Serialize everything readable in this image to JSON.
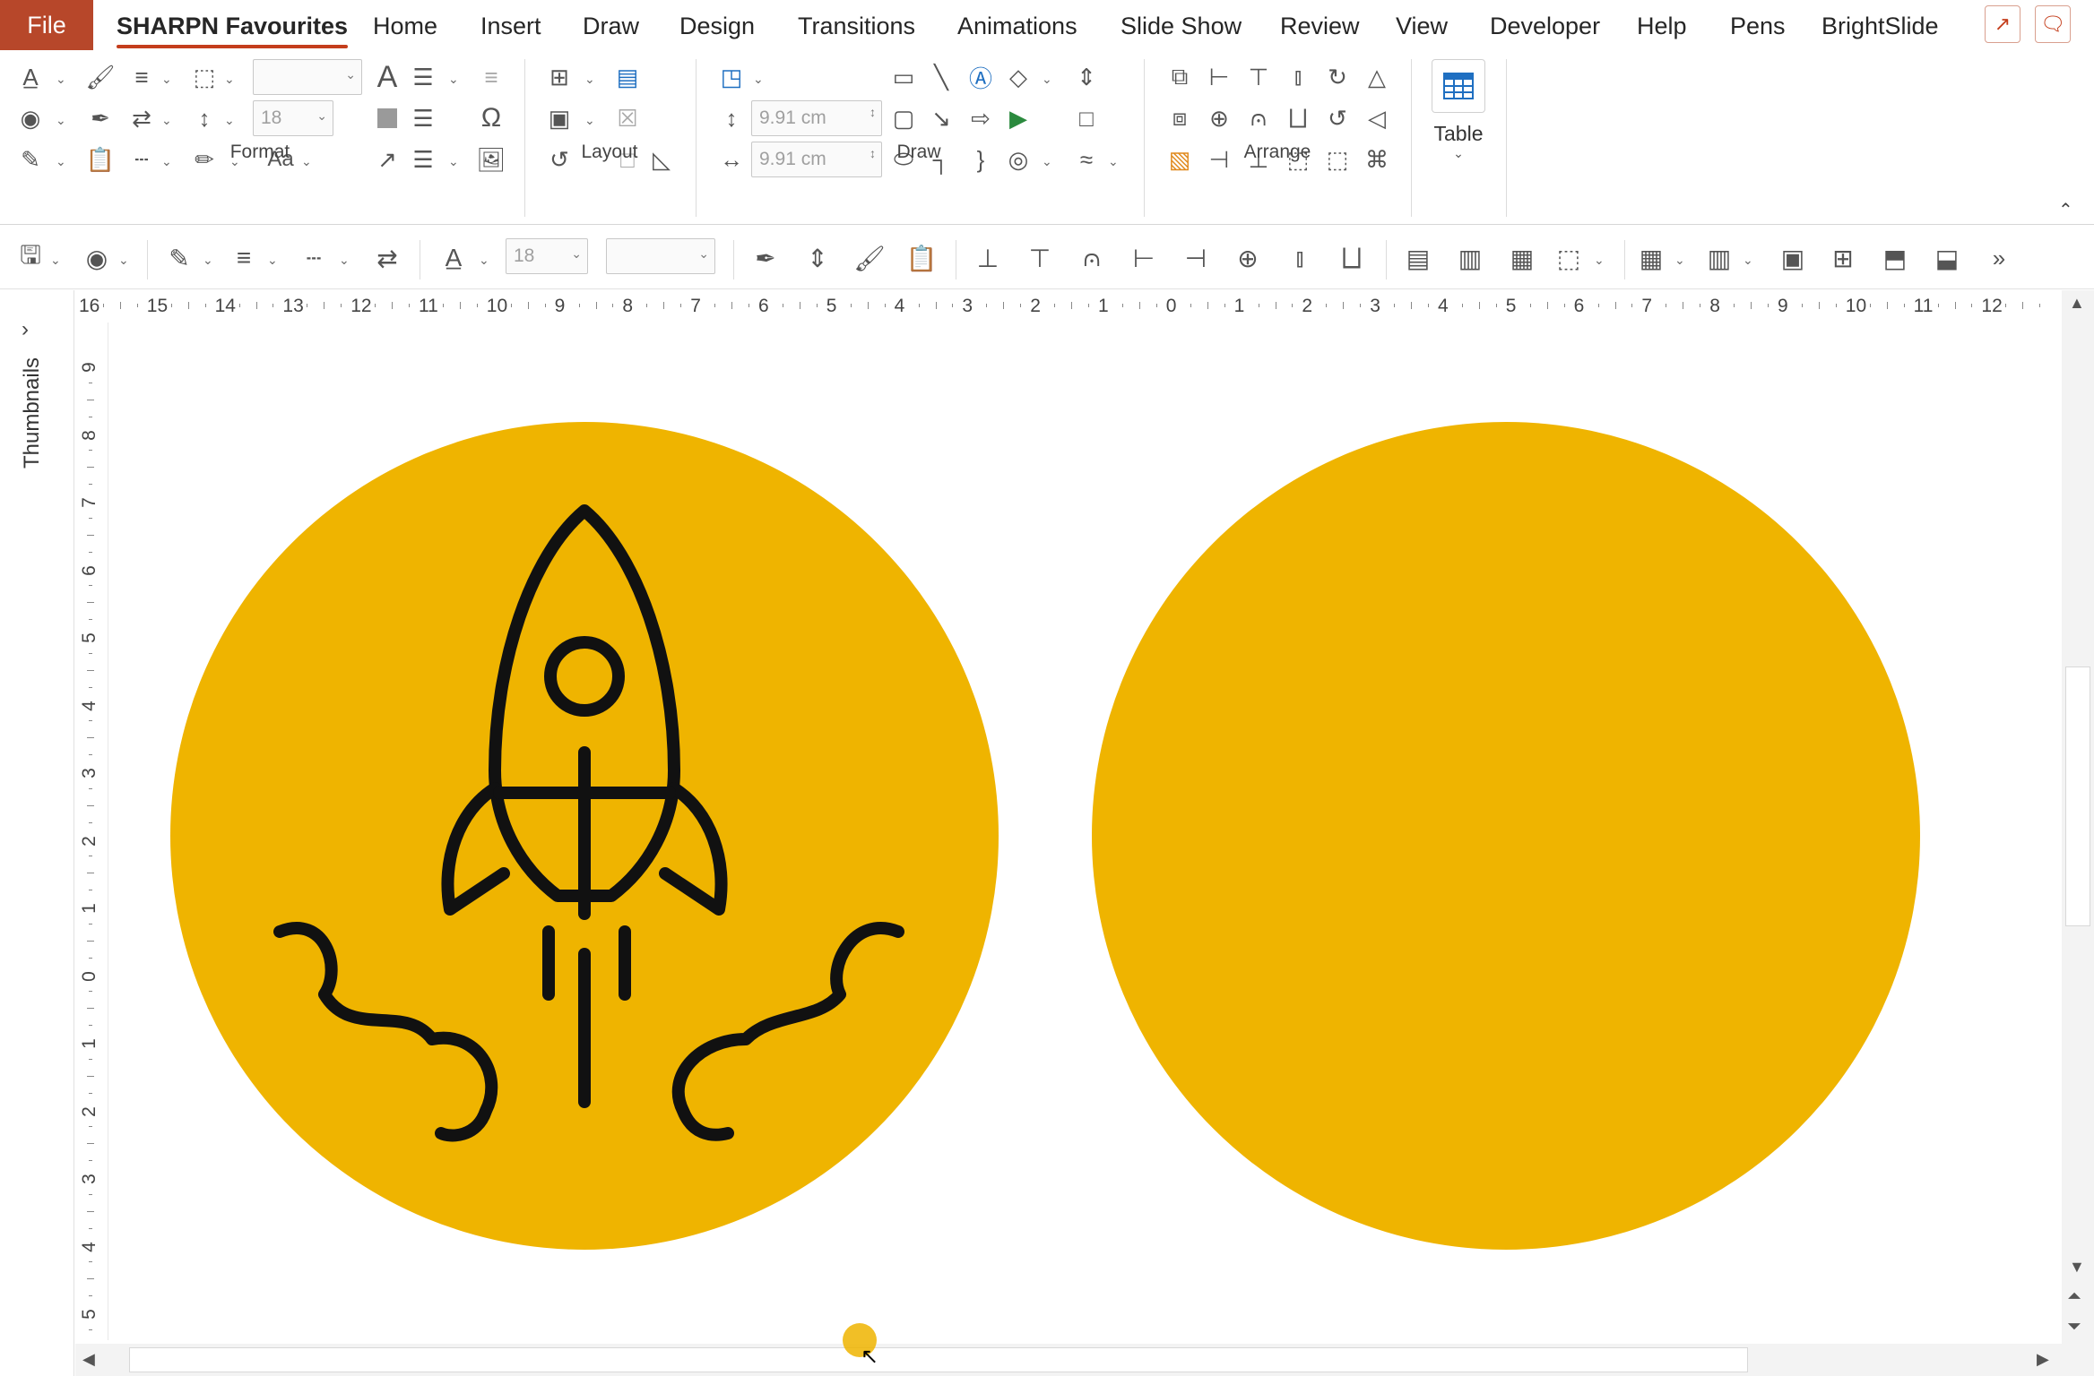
{
  "tabs": {
    "file": "File",
    "items": [
      "SHARPN Favourites",
      "Home",
      "Insert",
      "Draw",
      "Design",
      "Transitions",
      "Animations",
      "Slide Show",
      "Review",
      "View",
      "Developer",
      "Help",
      "Pens",
      "BrightSlide"
    ],
    "active": "SHARPN Favourites"
  },
  "ribbon": {
    "groups": {
      "format": "Format",
      "layout": "Layout",
      "draw": "Draw",
      "arrange": "Arrange"
    },
    "font_size_value": "18",
    "height_value": "9.91 cm",
    "width_value": "9.91 cm",
    "table_label": "Table",
    "text_case_label": "Aa"
  },
  "qat": {
    "font_size_value": "18",
    "more_label": "»"
  },
  "left_pane": {
    "label": "Thumbnails",
    "expand_icon": "chevron-right-icon"
  },
  "rulers": {
    "horizontal": [
      "16",
      "15",
      "14",
      "13",
      "12",
      "11",
      "10",
      "9",
      "8",
      "7",
      "6",
      "5",
      "4",
      "3",
      "2",
      "1",
      "0",
      "1",
      "2",
      "3",
      "4",
      "5",
      "6",
      "7",
      "8",
      "9",
      "10",
      "11",
      "12"
    ],
    "vertical": [
      "9",
      "8",
      "7",
      "6",
      "5",
      "4",
      "3",
      "2",
      "1",
      "0",
      "1",
      "2",
      "3",
      "4",
      "5"
    ]
  },
  "colors": {
    "file_tab": "#b7472a",
    "accent": "#c43e1c",
    "circle_fill": "#efb400",
    "icon_stroke": "#111111"
  }
}
